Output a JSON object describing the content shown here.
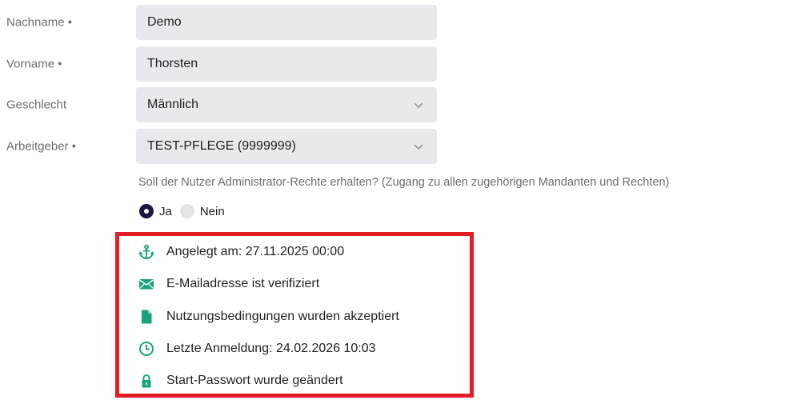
{
  "form": {
    "lastname": {
      "label": "Nachname •",
      "value": "Demo"
    },
    "firstname": {
      "label": "Vorname •",
      "value": "Thorsten"
    },
    "gender": {
      "label": "Geschlecht",
      "value": "Männlich"
    },
    "employer": {
      "label": "Arbeitgeber •",
      "value": "TEST-PFLEGE (9999999)"
    }
  },
  "admin": {
    "question": "Soll der Nutzer Administrator-Rechte erhalten? (Zugang zu allen zugehörigen Mandanten und Rechten)",
    "options": [
      "Ja",
      "Nein"
    ],
    "selected": "Ja"
  },
  "status": {
    "items": [
      {
        "icon": "anchor-icon",
        "text": "Angelegt am: 27.11.2025 00:00"
      },
      {
        "icon": "envelope-icon",
        "text": "E-Mailadresse ist verifiziert"
      },
      {
        "icon": "document-icon",
        "text": "Nutzungsbedingungen wurden akzeptiert"
      },
      {
        "icon": "clock-icon",
        "text": "Letzte Anmeldung: 24.02.2026 10:03"
      },
      {
        "icon": "lock-icon",
        "text": "Start-Passwort wurde geändert"
      }
    ]
  },
  "colors": {
    "icon_green": "#1aa37a",
    "highlight_red": "#e11e25",
    "radio_selected": "#1c1645",
    "field_bg": "#e7e9ec"
  }
}
